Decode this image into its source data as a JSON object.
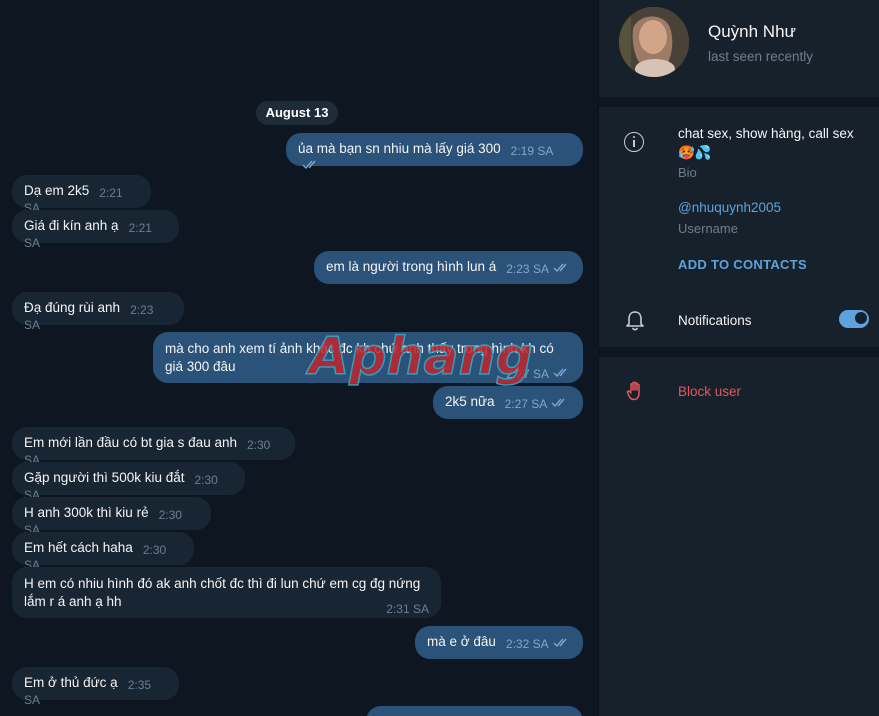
{
  "chat": {
    "date_label": "August 13",
    "messages": [
      {
        "dir": "out",
        "text": "ủa mà bạn sn nhiu mà lấy giá 300",
        "time": "2:19 SA"
      },
      {
        "dir": "in",
        "text": "Dạ em 2k5",
        "time": "2:21 SA"
      },
      {
        "dir": "in",
        "text": "Giá đi kín anh ạ",
        "time": "2:21 SA"
      },
      {
        "dir": "out",
        "text": "em là người trong hình lun á",
        "time": "2:23 SA"
      },
      {
        "dir": "in",
        "text": "Đạ đúng rùi anh",
        "time": "2:23 SA"
      },
      {
        "dir": "out",
        "text": "mà cho anh xem tí ảnh khác đc kh chứ anh thấy trong hình kh có giá 300 đâu",
        "time": "2:27 SA"
      },
      {
        "dir": "out",
        "text": "2k5 nữa",
        "time": "2:27 SA"
      },
      {
        "dir": "in",
        "text": "Em mới lần đầu có bt gia s đau anh",
        "time": "2:30 SA"
      },
      {
        "dir": "in",
        "text": "Gặp người thì 500k kiu đắt",
        "time": "2:30 SA"
      },
      {
        "dir": "in",
        "text": "H anh 300k thì kiu rẻ",
        "time": "2:30 SA"
      },
      {
        "dir": "in",
        "text": "Em hết cách haha",
        "time": "2:30 SA"
      },
      {
        "dir": "in",
        "text": "H em có nhiu hình đó ak anh chốt đc thì đi lun chứ em cg đg nứng lắm r á anh ạ hh",
        "time": "2:31 SA"
      },
      {
        "dir": "out",
        "text": "mà e ở đâu",
        "time": "2:32 SA"
      },
      {
        "dir": "in",
        "text": "Em ở thủ đức ạ",
        "time": "2:35 SA"
      }
    ],
    "watermark": "Aphang"
  },
  "profile": {
    "name": "Quỳnh Như",
    "status": "last seen recently",
    "bio": "chat sex, show hàng, call sex 🥵💦",
    "bio_label": "Bio",
    "username": "@nhuquynh2005",
    "username_label": "Username",
    "add_contact": "ADD TO CONTACTS",
    "notifications_label": "Notifications",
    "notifications_on": true,
    "block_label": "Block user"
  },
  "colors": {
    "chat_bg": "#0e1621",
    "panel_bg": "#17212b",
    "incoming_bubble": "#182533",
    "outgoing_bubble": "#2b5278",
    "accent": "#5fa2dd",
    "danger": "#e5565b"
  },
  "icons": [
    "info-icon",
    "bell-icon",
    "stop-hand-icon",
    "double-check-icon"
  ]
}
